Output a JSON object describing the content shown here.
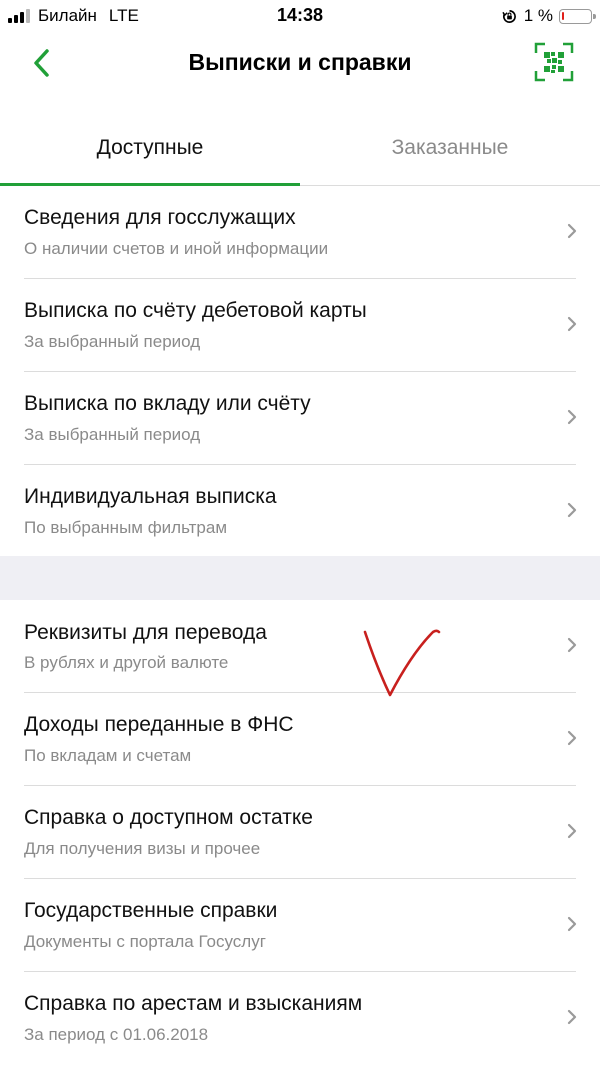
{
  "status_bar": {
    "carrier": "Билайн",
    "network": "LTE",
    "time": "14:38",
    "battery_text": "1 %",
    "battery_percent": 1,
    "battery_color": "#e0201b"
  },
  "header": {
    "title": "Выписки и справки",
    "back_icon": "chevron-left-icon",
    "action_icon": "qr-scan-icon",
    "accent_color": "#21a038"
  },
  "tabs": [
    {
      "label": "Доступные",
      "active": true
    },
    {
      "label": "Заказанные",
      "active": false
    }
  ],
  "group1": [
    {
      "title": "Сведения для госслужащих",
      "subtitle": "О наличии счетов и иной информации"
    },
    {
      "title": "Выписка по счёту дебетовой карты",
      "subtitle": "За выбранный период"
    },
    {
      "title": "Выписка по вкладу или счёту",
      "subtitle": "За выбранный период"
    },
    {
      "title": "Индивидуальная выписка",
      "subtitle": "По выбранным фильтрам"
    }
  ],
  "group2": [
    {
      "title": "Реквизиты для перевода",
      "subtitle": "В рублях и другой валюте"
    },
    {
      "title": "Доходы переданные в ФНС",
      "subtitle": "По вкладам и счетам"
    },
    {
      "title": "Справка о доступном остатке",
      "subtitle": "Для получения визы и прочее"
    },
    {
      "title": "Государственные справки",
      "subtitle": "Документы с портала Госуслуг"
    },
    {
      "title": "Справка по арестам и взысканиям",
      "subtitle": "За период с 01.06.2018"
    }
  ],
  "annotation": {
    "type": "handwritten-checkmark",
    "color": "#c8201e"
  }
}
